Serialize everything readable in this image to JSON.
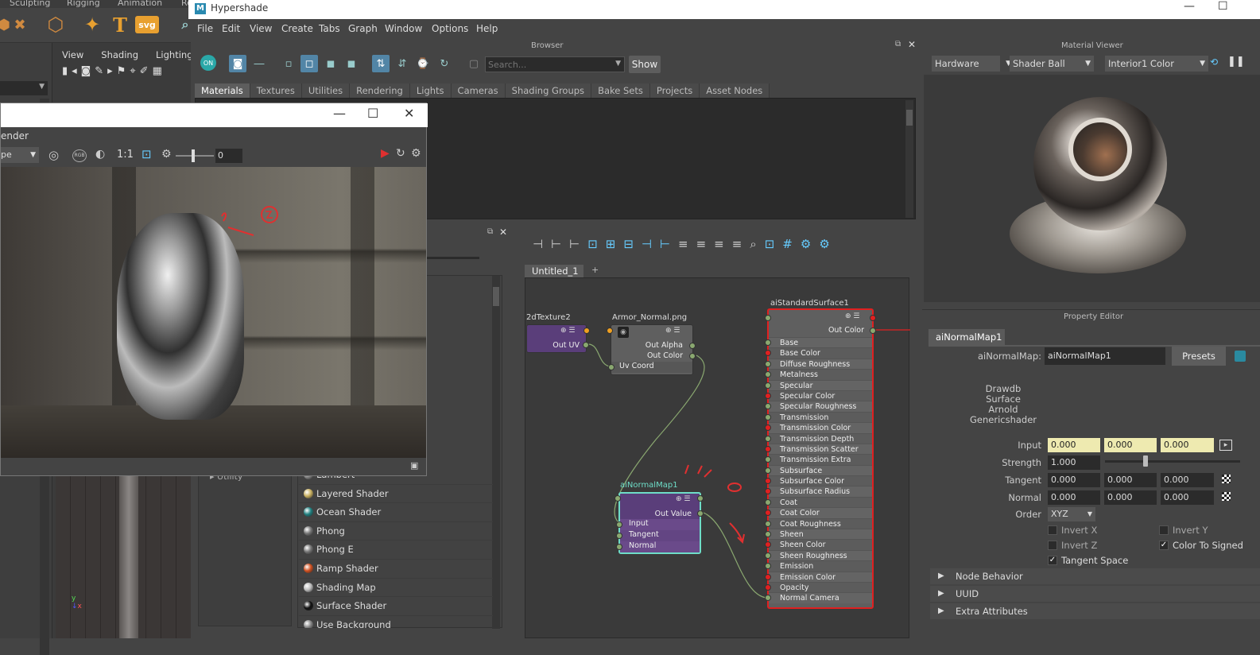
{
  "maya": {
    "shelf_tabs": [
      "Sculpting",
      "Rigging",
      "Animation",
      "Re"
    ],
    "viewport_menu": [
      "View",
      "Shading",
      "Lighting"
    ],
    "outliner_item": "Utility"
  },
  "hypershade": {
    "title": "Hypershade",
    "menu": [
      "File",
      "Edit",
      "View",
      "Create",
      "Tabs",
      "Graph",
      "Window",
      "Options",
      "Help"
    ],
    "browser": {
      "title": "Browser",
      "search_placeholder": "Search...",
      "show_label": "Show",
      "tabs": [
        "Materials",
        "Textures",
        "Utilities",
        "Rendering",
        "Lights",
        "Cameras",
        "Shading Groups",
        "Bake Sets",
        "Projects",
        "Asset Nodes"
      ]
    },
    "material_list": [
      {
        "label": "Lambert",
        "color": "#888888"
      },
      {
        "label": "Layered Shader",
        "color": "#c8b060"
      },
      {
        "label": "Ocean Shader",
        "color": "#208080"
      },
      {
        "label": "Phong",
        "color": "#777777"
      },
      {
        "label": "Phong E",
        "color": "#777777"
      },
      {
        "label": "Ramp Shader",
        "color": "#d05020"
      },
      {
        "label": "Shading Map",
        "color": "#bbbbbb"
      },
      {
        "label": "Surface Shader",
        "color": "#111111"
      },
      {
        "label": "Use Background",
        "color": "#888888"
      }
    ],
    "graph_tabs": [
      "Untitled_1",
      "+"
    ],
    "nodes": {
      "place2d": {
        "title": "2dTexture2",
        "out": "Out UV"
      },
      "file": {
        "title": "Armor_Normal.png",
        "out1": "Out Alpha",
        "out2": "Out Color",
        "in1": "Uv Coord"
      },
      "normal": {
        "title": "aiNormalMap1",
        "out": "Out Value",
        "inputs": [
          "Input",
          "Tangent",
          "Normal"
        ]
      },
      "surface": {
        "title": "aiStandardSurface1",
        "out": "Out Color",
        "attrs": [
          "Base",
          "Base Color",
          "Diffuse Roughness",
          "Metalness",
          "Specular",
          "Specular Color",
          "Specular Roughness",
          "Transmission",
          "Transmission Color",
          "Transmission Depth",
          "Transmission Scatter",
          "Transmission Extra Roughness",
          "Subsurface",
          "Subsurface Color",
          "Subsurface Radius",
          "Coat",
          "Coat Color",
          "Coat Roughness",
          "Sheen",
          "Sheen Color",
          "Sheen Roughness",
          "Emission",
          "Emission Color",
          "Opacity",
          "Normal Camera"
        ]
      }
    },
    "material_viewer": {
      "title": "Material Viewer",
      "renderer": "Hardware",
      "shape": "Shader Ball",
      "env": "Interior1 Color"
    },
    "property_editor": {
      "title": "Property Editor",
      "tab": "aiNormalMap1",
      "node_type_label": "aiNormalMap:",
      "node_name": "aiNormalMap1",
      "presets": "Presets",
      "classification": [
        "Drawdb",
        "Surface",
        "Arnold",
        "Genericshader"
      ],
      "input_label": "Input",
      "input": [
        "0.000",
        "0.000",
        "0.000"
      ],
      "strength_label": "Strength",
      "strength": "1.000",
      "strength_fraction": 0.3,
      "tangent_label": "Tangent",
      "tangent": [
        "0.000",
        "0.000",
        "0.000"
      ],
      "normal_label": "Normal",
      "normal": [
        "0.000",
        "0.000",
        "0.000"
      ],
      "order_label": "Order",
      "order": "XYZ",
      "invert_x": "Invert X",
      "invert_y": "Invert Y",
      "invert_z": "Invert Z",
      "color_to_signed": "Color To Signed",
      "tangent_space": "Tangent Space",
      "sections": [
        "Node Behavior",
        "UUID",
        "Extra Attributes"
      ]
    }
  },
  "render_view": {
    "title": "ender",
    "camera": "pe",
    "ratio": "1:1",
    "frame_value": "0",
    "rgb": "RGB"
  }
}
